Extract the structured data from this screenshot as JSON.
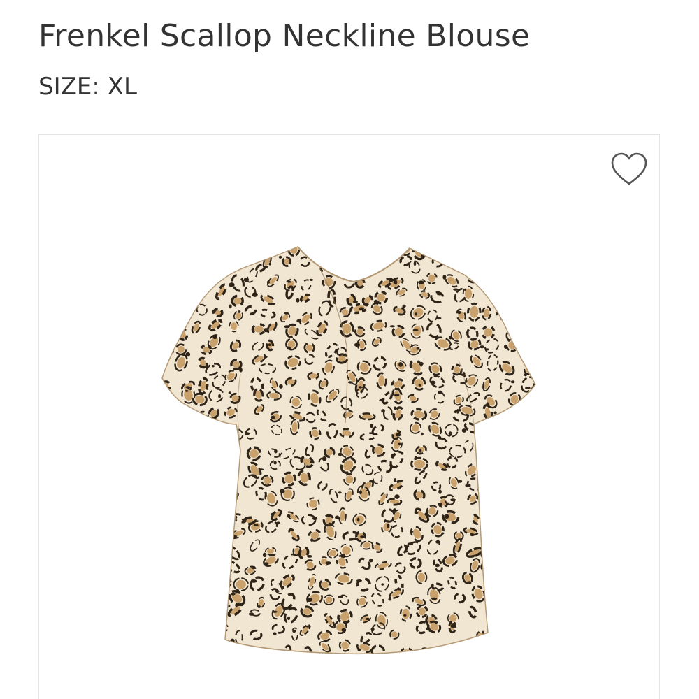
{
  "product": {
    "title": "Frenkel Scallop Neckline Blouse",
    "size_text": "SIZE: XL",
    "image_description_icon": "leopard-print-blouse",
    "colors": {
      "base": "#f1e6d2",
      "tan": "#c9a16c",
      "dark": "#2f2418"
    }
  },
  "actions": {
    "favorite_icon": "heart-outline-icon"
  }
}
